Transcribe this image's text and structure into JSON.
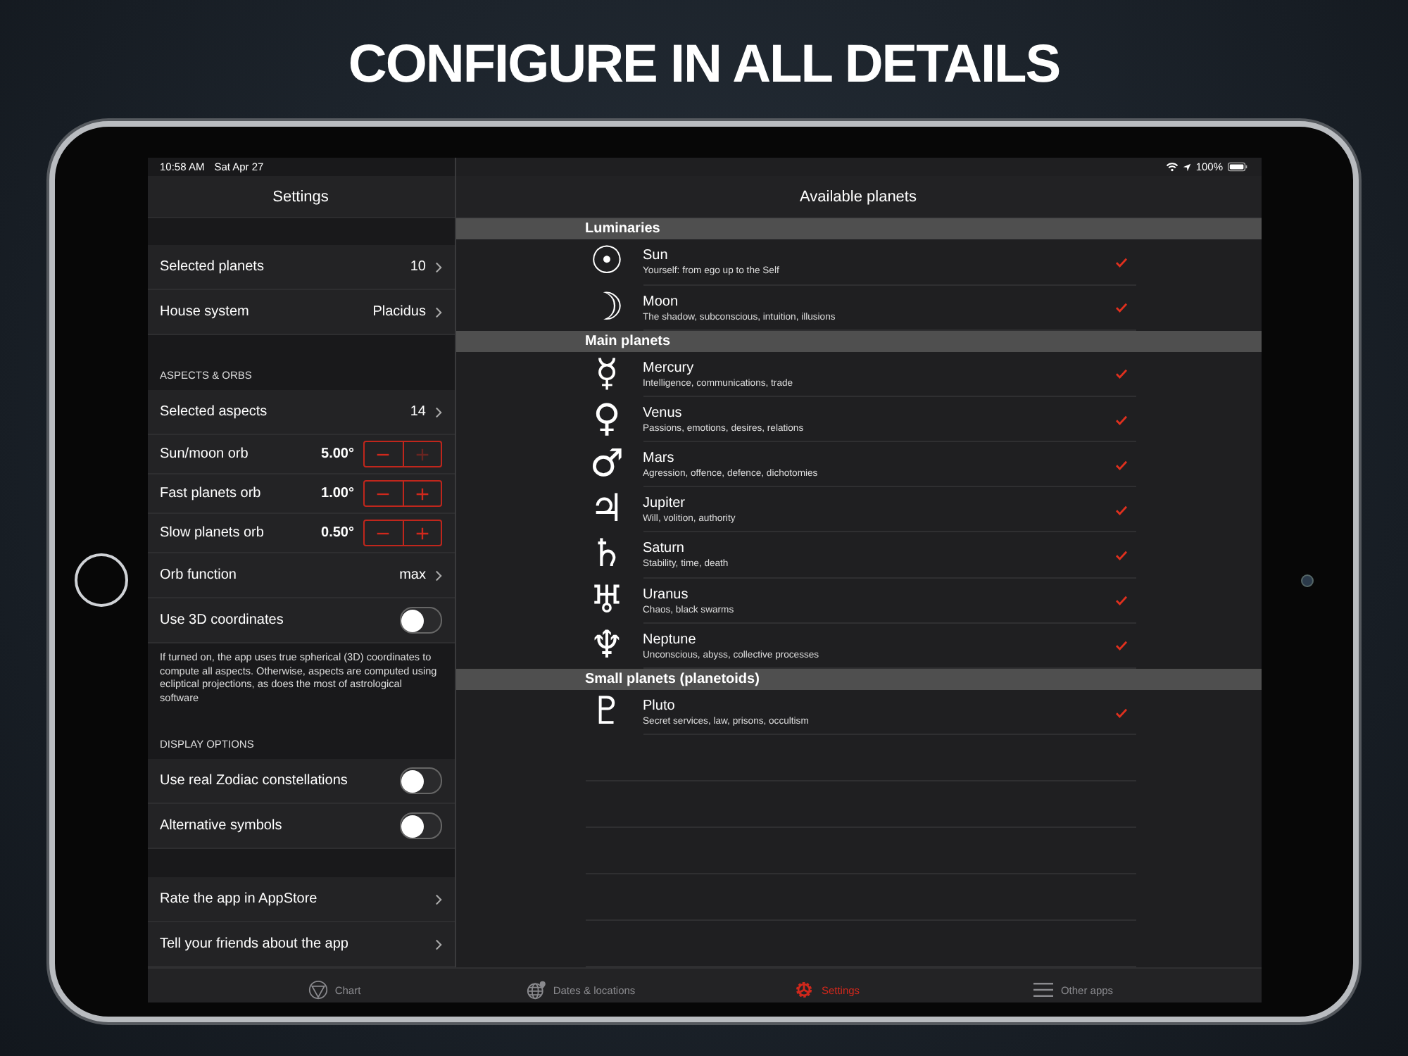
{
  "headline": "CONFIGURE IN ALL DETAILS",
  "status_bar": {
    "time": "10:58 AM",
    "date": "Sat Apr 27",
    "battery": "100%"
  },
  "settings": {
    "title": "Settings",
    "sections": [
      {
        "rows": [
          {
            "kind": "link",
            "label": "Selected planets",
            "value": "10"
          },
          {
            "kind": "link",
            "label": "House system",
            "value": "Placidus"
          }
        ]
      },
      {
        "header": "ASPECTS & ORBS",
        "rows": [
          {
            "kind": "link",
            "label": "Selected aspects",
            "value": "14"
          },
          {
            "kind": "stepper",
            "label": "Sun/moon orb",
            "value": "5.00°",
            "minus_disabled": false,
            "plus_disabled": true
          },
          {
            "kind": "stepper",
            "label": "Fast planets orb",
            "value": "1.00°",
            "minus_disabled": false,
            "plus_disabled": false
          },
          {
            "kind": "stepper",
            "label": "Slow planets orb",
            "value": "0.50°",
            "minus_disabled": false,
            "plus_disabled": false
          },
          {
            "kind": "link",
            "label": "Orb function",
            "value": "max"
          },
          {
            "kind": "toggle",
            "label": "Use 3D coordinates",
            "on": false
          }
        ],
        "footer": "If turned on, the app uses true spherical (3D) coordinates to compute all aspects. Otherwise, aspects are computed using ecliptical projections, as does the most of astrological software"
      },
      {
        "header": "DISPLAY OPTIONS",
        "rows": [
          {
            "kind": "toggle",
            "label": "Use real Zodiac constellations",
            "on": false
          },
          {
            "kind": "toggle",
            "label": "Alternative symbols",
            "on": false
          }
        ]
      },
      {
        "rows": [
          {
            "kind": "link",
            "label": "Rate the app in AppStore"
          },
          {
            "kind": "link",
            "label": "Tell your friends about the app"
          }
        ]
      }
    ]
  },
  "planets": {
    "title": "Available planets",
    "groups": [
      {
        "name": "Luminaries",
        "planets": [
          {
            "symbol": "☉",
            "name": "Sun",
            "description": "Yourself: from ego up to the Self",
            "checked": true
          },
          {
            "symbol": "☽",
            "name": "Moon",
            "description": "The shadow, subconscious, intuition, illusions",
            "checked": true
          }
        ]
      },
      {
        "name": "Main planets",
        "planets": [
          {
            "symbol": "☿",
            "name": "Mercury",
            "description": "Intelligence, communications, trade",
            "checked": true
          },
          {
            "symbol": "♀",
            "name": "Venus",
            "description": "Passions, emotions, desires, relations",
            "checked": true
          },
          {
            "symbol": "♂",
            "name": "Mars",
            "description": "Agression, offence, defence, dichotomies",
            "checked": true
          },
          {
            "symbol": "♃",
            "name": "Jupiter",
            "description": "Will, volition, authority",
            "checked": true
          },
          {
            "symbol": "♄",
            "name": "Saturn",
            "description": "Stability, time, death",
            "checked": true
          },
          {
            "symbol": "♅",
            "name": "Uranus",
            "description": "Chaos, black swarms",
            "checked": true
          },
          {
            "symbol": "♆",
            "name": "Neptune",
            "description": "Unconscious, abyss, collective processes",
            "checked": true
          }
        ]
      },
      {
        "name": "Small planets (planetoids)",
        "planets": [
          {
            "symbol": "♇",
            "name": "Pluto",
            "description": "Secret services, law, prisons, occultism",
            "checked": true
          }
        ]
      }
    ]
  },
  "tabs": [
    {
      "kind": "chart",
      "label": "Chart",
      "selected": false
    },
    {
      "kind": "globe",
      "label": "Dates & locations",
      "selected": false
    },
    {
      "kind": "gear",
      "label": "Settings",
      "selected": true
    },
    {
      "kind": "menu",
      "label": "Other apps",
      "selected": false
    }
  ]
}
